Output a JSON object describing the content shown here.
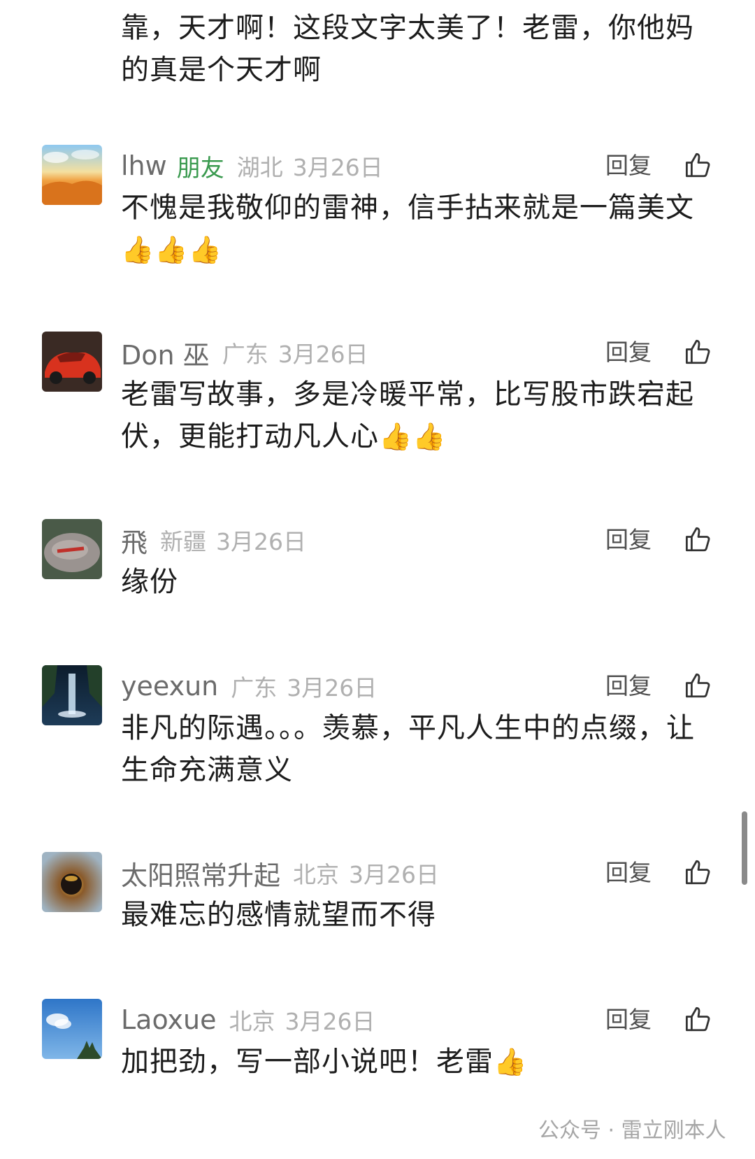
{
  "top_comment": {
    "text": "靠，天才啊！这段文字太美了！老雷，你他妈的真是个天才啊"
  },
  "reply_label": "回复",
  "colors": {
    "friend_tag": "#3a9a4f",
    "meta_gray": "#b0b0b0",
    "text": "#1c1c1c"
  },
  "comments": [
    {
      "name": "lhw",
      "friend_tag": "朋友",
      "location": "湖北",
      "date": "3月26日",
      "text": "不愧是我敬仰的雷神，信手拈来就是一篇美文",
      "emoji": "👍👍👍",
      "avatar": "wheat-field-avatar"
    },
    {
      "name": "Don 巫",
      "location": "广东",
      "date": "3月26日",
      "text": "老雷写故事，多是冷暖平常，比写股市跌宕起伏，更能打动凡人心",
      "emoji": "👍👍",
      "avatar": "red-car-avatar"
    },
    {
      "name": "飛",
      "location": "新疆",
      "date": "3月26日",
      "text": "缘份",
      "avatar": "stone-avatar"
    },
    {
      "name": "yeexun",
      "location": "广东",
      "date": "3月26日",
      "text": "非凡的际遇。。。羡慕，平凡人生中的点缀，让生命充满意义",
      "avatar": "waterfall-avatar"
    },
    {
      "name": "太阳照常升起",
      "location": "北京",
      "date": "3月26日",
      "text": "最难忘的感情就望而不得",
      "avatar": "sun-avatar"
    },
    {
      "name": "Laoxue",
      "location": "北京",
      "date": "3月26日",
      "text": "加把劲，写一部小说吧！老雷",
      "emoji": "👍",
      "avatar": "sky-avatar"
    }
  ],
  "watermark": "公众号 · 雷立刚本人"
}
